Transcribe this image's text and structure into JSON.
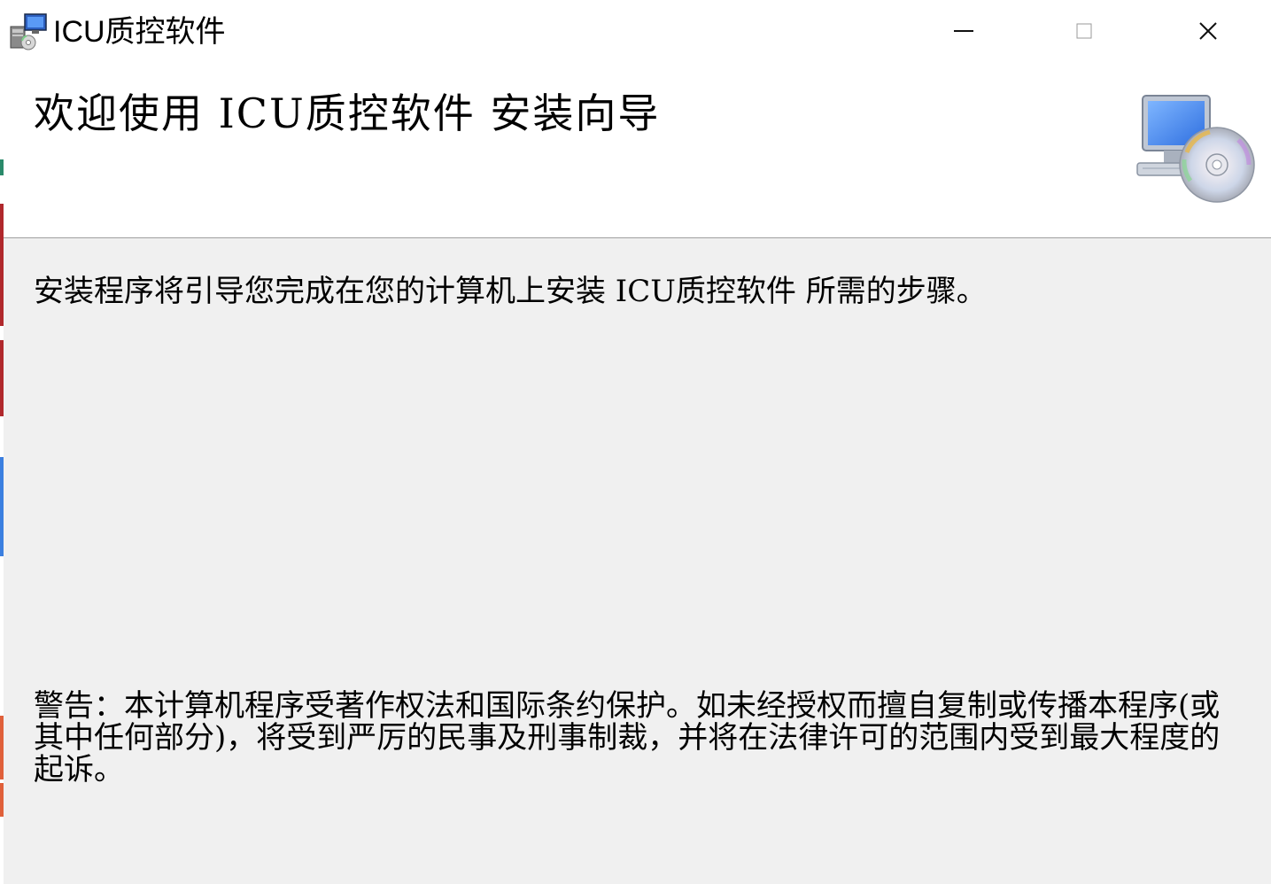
{
  "window": {
    "title": "ICU质控软件",
    "minimize_label": "Minimize",
    "maximize_label": "Maximize",
    "close_label": "Close"
  },
  "banner": {
    "title": "欢迎使用 ICU质控软件 安装向导",
    "graphic": "computer-cd-icon"
  },
  "content": {
    "intro": "安装程序将引导您完成在您的计算机上安装 ICU质控软件 所需的步骤。",
    "warning": "警告：本计算机程序受著作权法和国际条约保护。如未经授权而擅自复制或传播本程序(或其中任何部分)，将受到严厉的民事及刑事制裁，并将在法律许可的范围内受到最大程度的起诉。"
  },
  "colors": {
    "window_bg": "#f0f0f0",
    "banner_bg": "#ffffff",
    "accent_blue": "#3b7fe0",
    "taskbar_red": "#b0282c",
    "taskbar_green": "#2a8a6a",
    "taskbar_orange": "#e0603a"
  }
}
